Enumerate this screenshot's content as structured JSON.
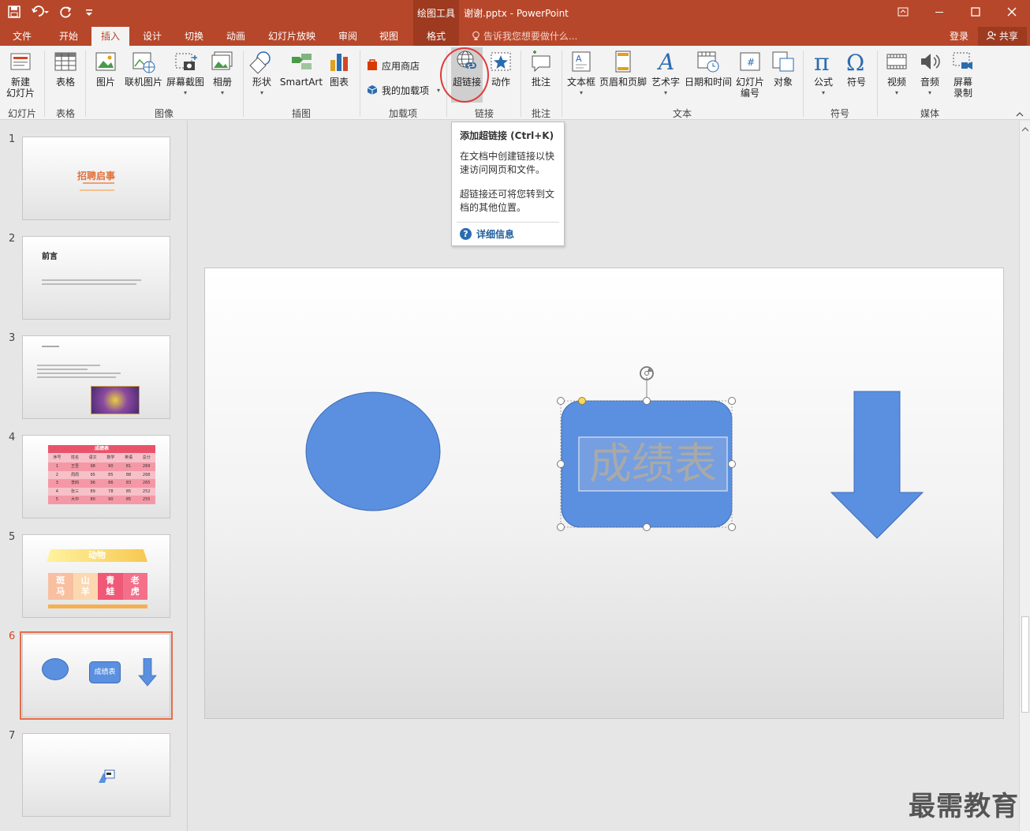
{
  "titlebar": {
    "context_tab": "绘图工具",
    "doc_title": "谢谢.pptx - PowerPoint"
  },
  "tabs": [
    "文件",
    "开始",
    "插入",
    "设计",
    "切换",
    "动画",
    "幻灯片放映",
    "审阅",
    "视图",
    "格式"
  ],
  "active_tab": "插入",
  "tell_me": "告诉我您想要做什么...",
  "login": "登录",
  "share": "共享",
  "ribbon": {
    "new_slide": "新建\n幻灯片",
    "table": "表格",
    "picture": "图片",
    "online_picture": "联机图片",
    "screenshot": "屏幕截图",
    "album": "相册",
    "shapes": "形状",
    "smartart": "SmartArt",
    "chart": "图表",
    "store": "应用商店",
    "my_addins": "我的加载项",
    "hyperlink": "超链接",
    "action": "动作",
    "comment": "批注",
    "textbox": "文本框",
    "header_footer": "页眉和页脚",
    "wordart": "艺术字",
    "datetime": "日期和时间",
    "slide_number": "幻灯片\n编号",
    "object": "对象",
    "equation": "公式",
    "symbol": "符号",
    "video": "视频",
    "audio": "音频",
    "screen_record": "屏幕\n录制",
    "groups": {
      "slides": "幻灯片",
      "tables": "表格",
      "images": "图像",
      "illustrations": "插图",
      "addins": "加载项",
      "links": "链接",
      "comments": "批注",
      "text": "文本",
      "symbols": "符号",
      "media": "媒体"
    }
  },
  "tooltip": {
    "title": "添加超链接 (Ctrl+K)",
    "p1": "在文档中创建链接以快速访问网页和文件。",
    "p2": "超链接还可将您转到文档的其他位置。",
    "more": "详细信息"
  },
  "thumbnails": {
    "numbers": [
      "1",
      "2",
      "3",
      "4",
      "5",
      "6",
      "7"
    ],
    "selected": 6,
    "s1_title": "招聘启事",
    "s2_title": "前言",
    "s4_title": "成绩表",
    "s4_headers": [
      "序号",
      "姓名",
      "语文",
      "数学",
      "英语",
      "总分"
    ],
    "s4_rows": [
      [
        "1",
        "王吾",
        "98",
        "90",
        "81",
        "269"
      ],
      [
        "2",
        "周周",
        "95",
        "85",
        "88",
        "268"
      ],
      [
        "3",
        "李四",
        "96",
        "86",
        "83",
        "265"
      ],
      [
        "4",
        "张三",
        "89",
        "78",
        "85",
        "252"
      ],
      [
        "5",
        "大中",
        "80",
        "90",
        "85",
        "255"
      ]
    ],
    "s5_title": "动物",
    "s5_items": [
      "斑\n马",
      "山\n羊",
      "青\n蛙",
      "老\n虎"
    ],
    "s6_label": "成绩表"
  },
  "slide": {
    "shape_text": "成绩表",
    "shape_color": "#5b8fdf"
  },
  "watermark": "最需教育"
}
